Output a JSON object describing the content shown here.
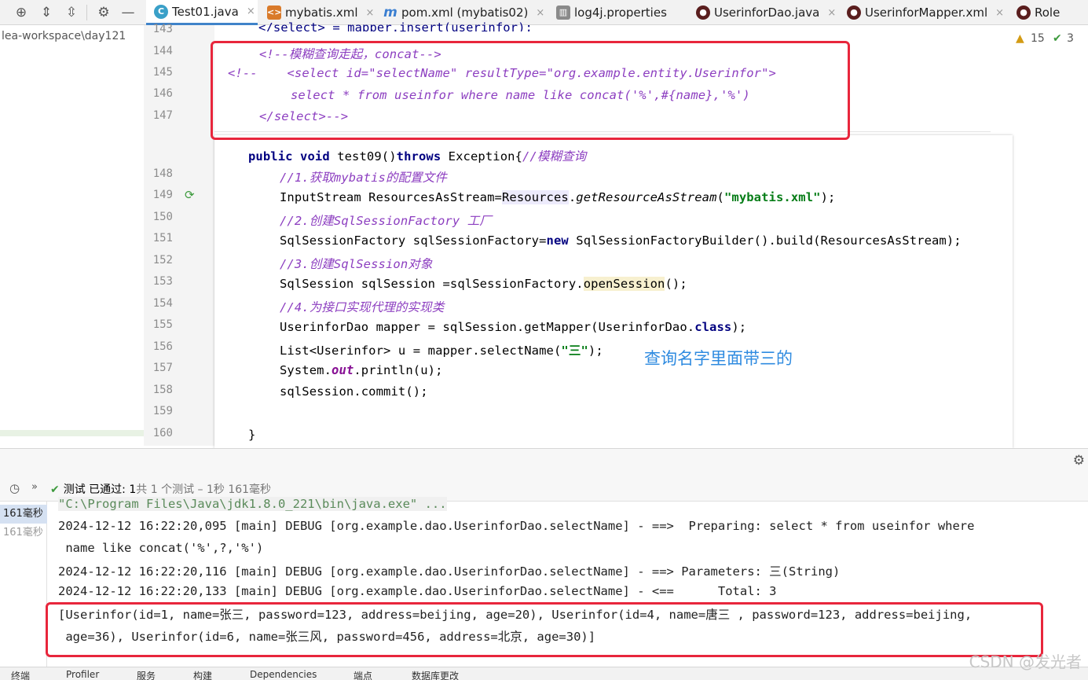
{
  "tabs": [
    {
      "label": "Test01.java",
      "icon": "java-class-icon",
      "active": true
    },
    {
      "label": "mybatis.xml",
      "icon": "xml-file-icon"
    },
    {
      "label": "pom.xml (mybatis02)",
      "icon": "maven-icon"
    },
    {
      "label": "log4j.properties",
      "icon": "properties-file-icon"
    },
    {
      "label": "UserinforDao.java",
      "icon": "java-interface-icon"
    },
    {
      "label": "UserinforMapper.xml",
      "icon": "mybatis-mapper-icon"
    },
    {
      "label": "Role",
      "icon": "mybatis-mapper-icon"
    }
  ],
  "close_glyph": "×",
  "project_path": "lea-workspace\\day121",
  "inspections": {
    "warnings": "15",
    "checks": "3"
  },
  "line_numbers": [
    "143",
    "144",
    "145",
    "146",
    "147",
    "148",
    "149",
    "150",
    "151",
    "152",
    "153",
    "154",
    "155",
    "156",
    "157",
    "158",
    "159",
    "160"
  ],
  "xml_code": {
    "l143": "</select> = mapper.insert(userinfor);",
    "l144": "<!--模糊查询走起，concat-->",
    "l145a": "<!--    ",
    "l145b": "<select id=\"selectName\" resultType=\"org.example.entity.Userinfor\">",
    "l146": "select * from useinfor where name like concat('%',#{name},'%')",
    "l147": "</select>-->"
  },
  "java_code": {
    "sig_kw1": "public",
    "sig_kw2": "void",
    "sig_name": " test09()",
    "sig_kw3": "throws",
    "sig_rest": " Exception{",
    "sig_comment": "//模糊查询",
    "c1": "//1.获取mybatis的配置文件",
    "l2a": "InputStream ResourcesAsStream=",
    "l2b": "Resources",
    "l2c": ".",
    "l2d": "getResourceAsStream",
    "l2e": "(",
    "l2f": "\"mybatis.xml\"",
    "l2g": ");",
    "c3": "//2.创建SqlSessionFactory 工厂",
    "l4a": "SqlSessionFactory sqlSessionFactory=",
    "l4b": "new",
    "l4c": " SqlSessionFactoryBuilder().build(ResourcesAsStream);",
    "c5": "//3.创建SqlSession对象",
    "l6a": "SqlSession sqlSession =sqlSessionFactory.",
    "l6b": "openSession",
    "l6c": "();",
    "c7": "//4.为接口实现代理的实现类",
    "l8a": "UserinforDao mapper = sqlSession.getMapper(UserinforDao.",
    "l8b": "class",
    "l8c": ");",
    "l9a": "List<Userinfor> u = mapper.selectName(",
    "l9b": "\"三\"",
    "l9c": ");",
    "l10a": "System.",
    "l10b": "out",
    "l10c": ".println(u);",
    "l11": "sqlSession.commit();",
    "l12": "}"
  },
  "annotation": "查询名字里面带三的",
  "run": {
    "passed_label": "测试 已通过: 1",
    "passed_detail": "共 1 个测试 – 1秒 161毫秒",
    "tree": [
      "161毫秒",
      "161毫秒"
    ],
    "console": [
      "\"C:\\Program Files\\Java\\jdk1.8.0_221\\bin\\java.exe\" ...",
      "2024-12-12 16:22:20,095 [main] DEBUG [org.example.dao.UserinforDao.selectName] - ==>  Preparing: select * from useinfor where",
      " name like concat('%',?,'%')",
      "2024-12-12 16:22:20,116 [main] DEBUG [org.example.dao.UserinforDao.selectName] - ==> Parameters: 三(String)",
      "2024-12-12 16:22:20,133 [main] DEBUG [org.example.dao.UserinforDao.selectName] - <==      Total: 3",
      "[Userinfor(id=1, name=张三, password=123, address=beijing, age=20), Userinfor(id=4, name=唐三 , password=123, address=beijing,",
      " age=36), Userinfor(id=6, name=张三风, password=456, address=北京, age=30)]"
    ]
  },
  "bottom_bar": [
    "终端",
    "Profiler",
    "服务",
    "构建",
    "Dependencies",
    "端点",
    "数据库更改"
  ],
  "watermark": "CSDN @发光者",
  "colors": {
    "accent": "#4083c9",
    "highlight_box": "#e8263c",
    "annotation": "#2f8be0"
  }
}
